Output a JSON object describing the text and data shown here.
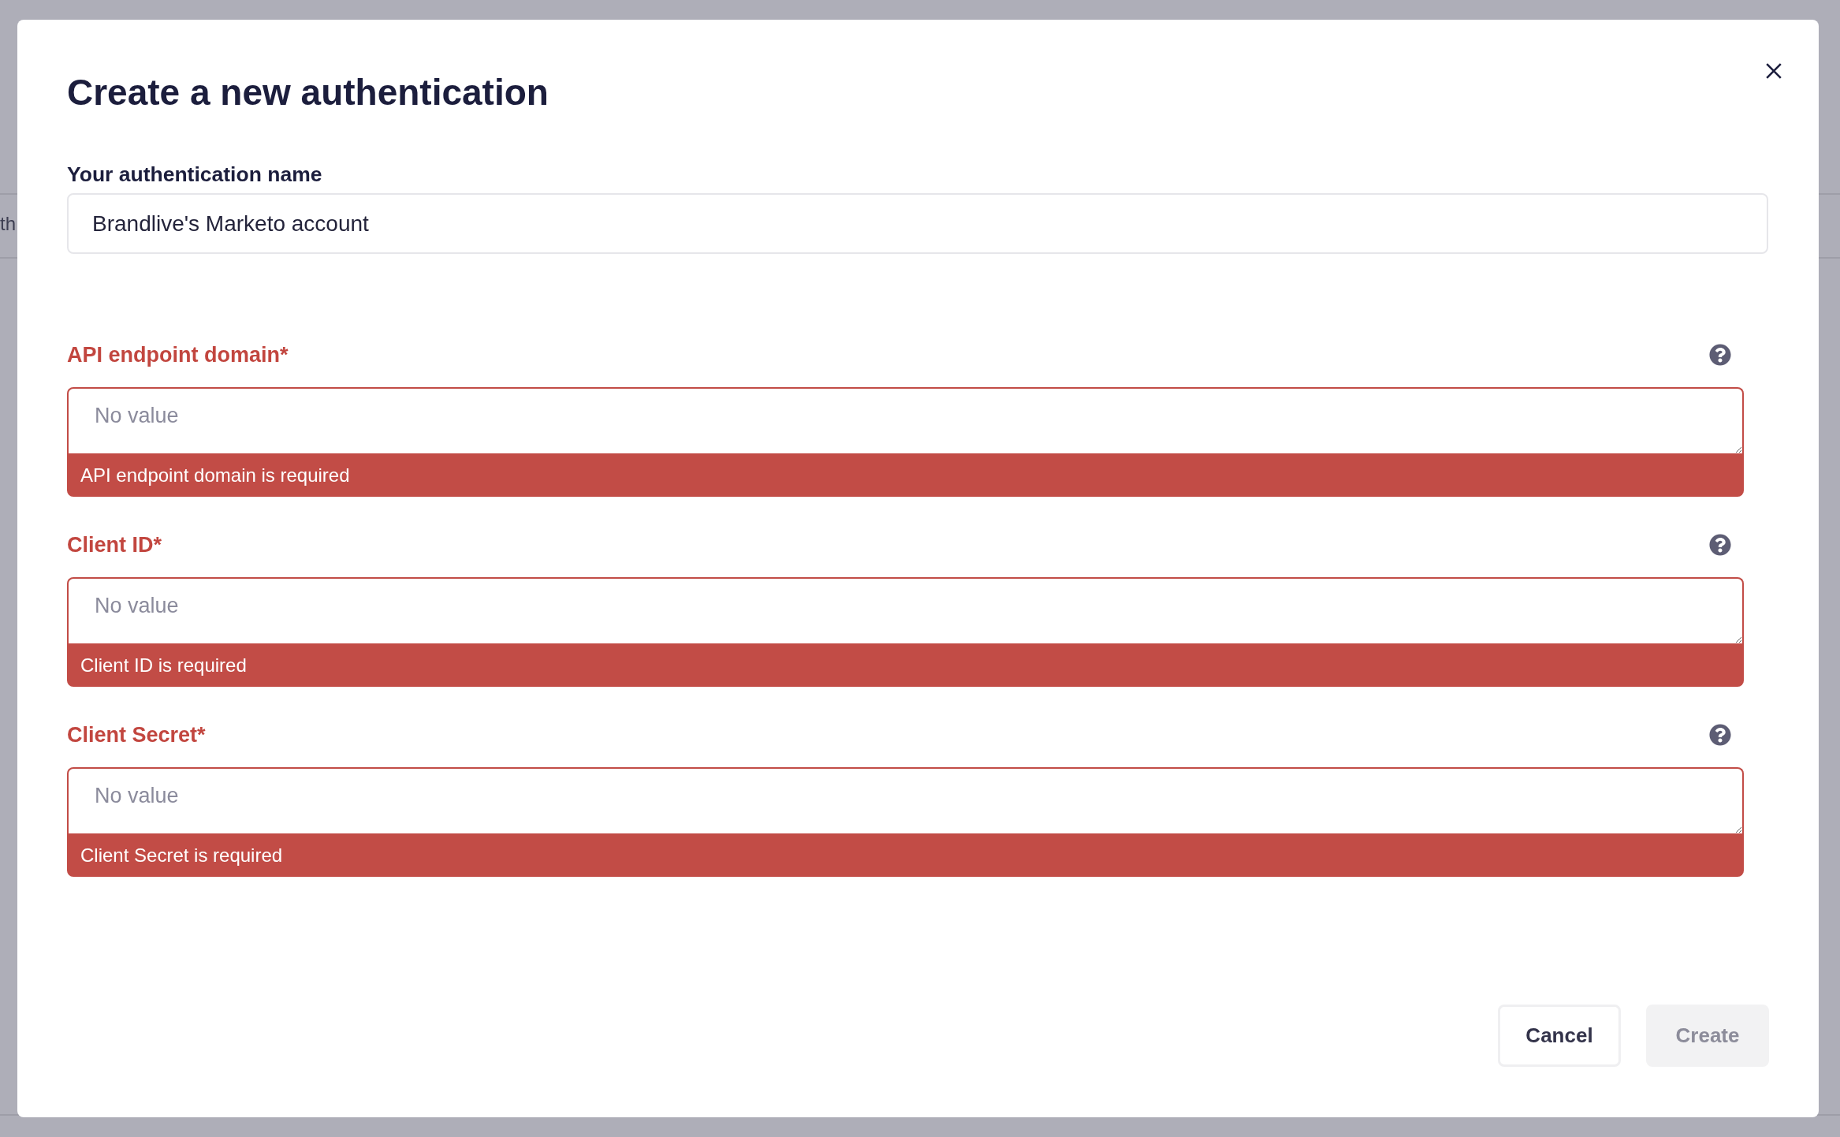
{
  "background": {
    "text_fragment": "th"
  },
  "dialog": {
    "title": "Create a new authentication"
  },
  "name_field": {
    "label": "Your authentication name",
    "value": "Brandlive's Marketo account"
  },
  "fields": [
    {
      "label": "API endpoint domain*",
      "placeholder": "No value",
      "invalid": true,
      "error": "API endpoint domain is required"
    },
    {
      "label": "Client ID*",
      "placeholder": "No value",
      "invalid": true,
      "error": "Client ID is required"
    },
    {
      "label": "Client Secret*",
      "placeholder": "No value",
      "invalid": true,
      "error": "Client Secret is required"
    }
  ],
  "buttons": [
    {
      "label": "Cancel",
      "kind": "secondary",
      "disabled": false
    },
    {
      "label": "Create",
      "kind": "primary",
      "disabled": true
    }
  ]
}
